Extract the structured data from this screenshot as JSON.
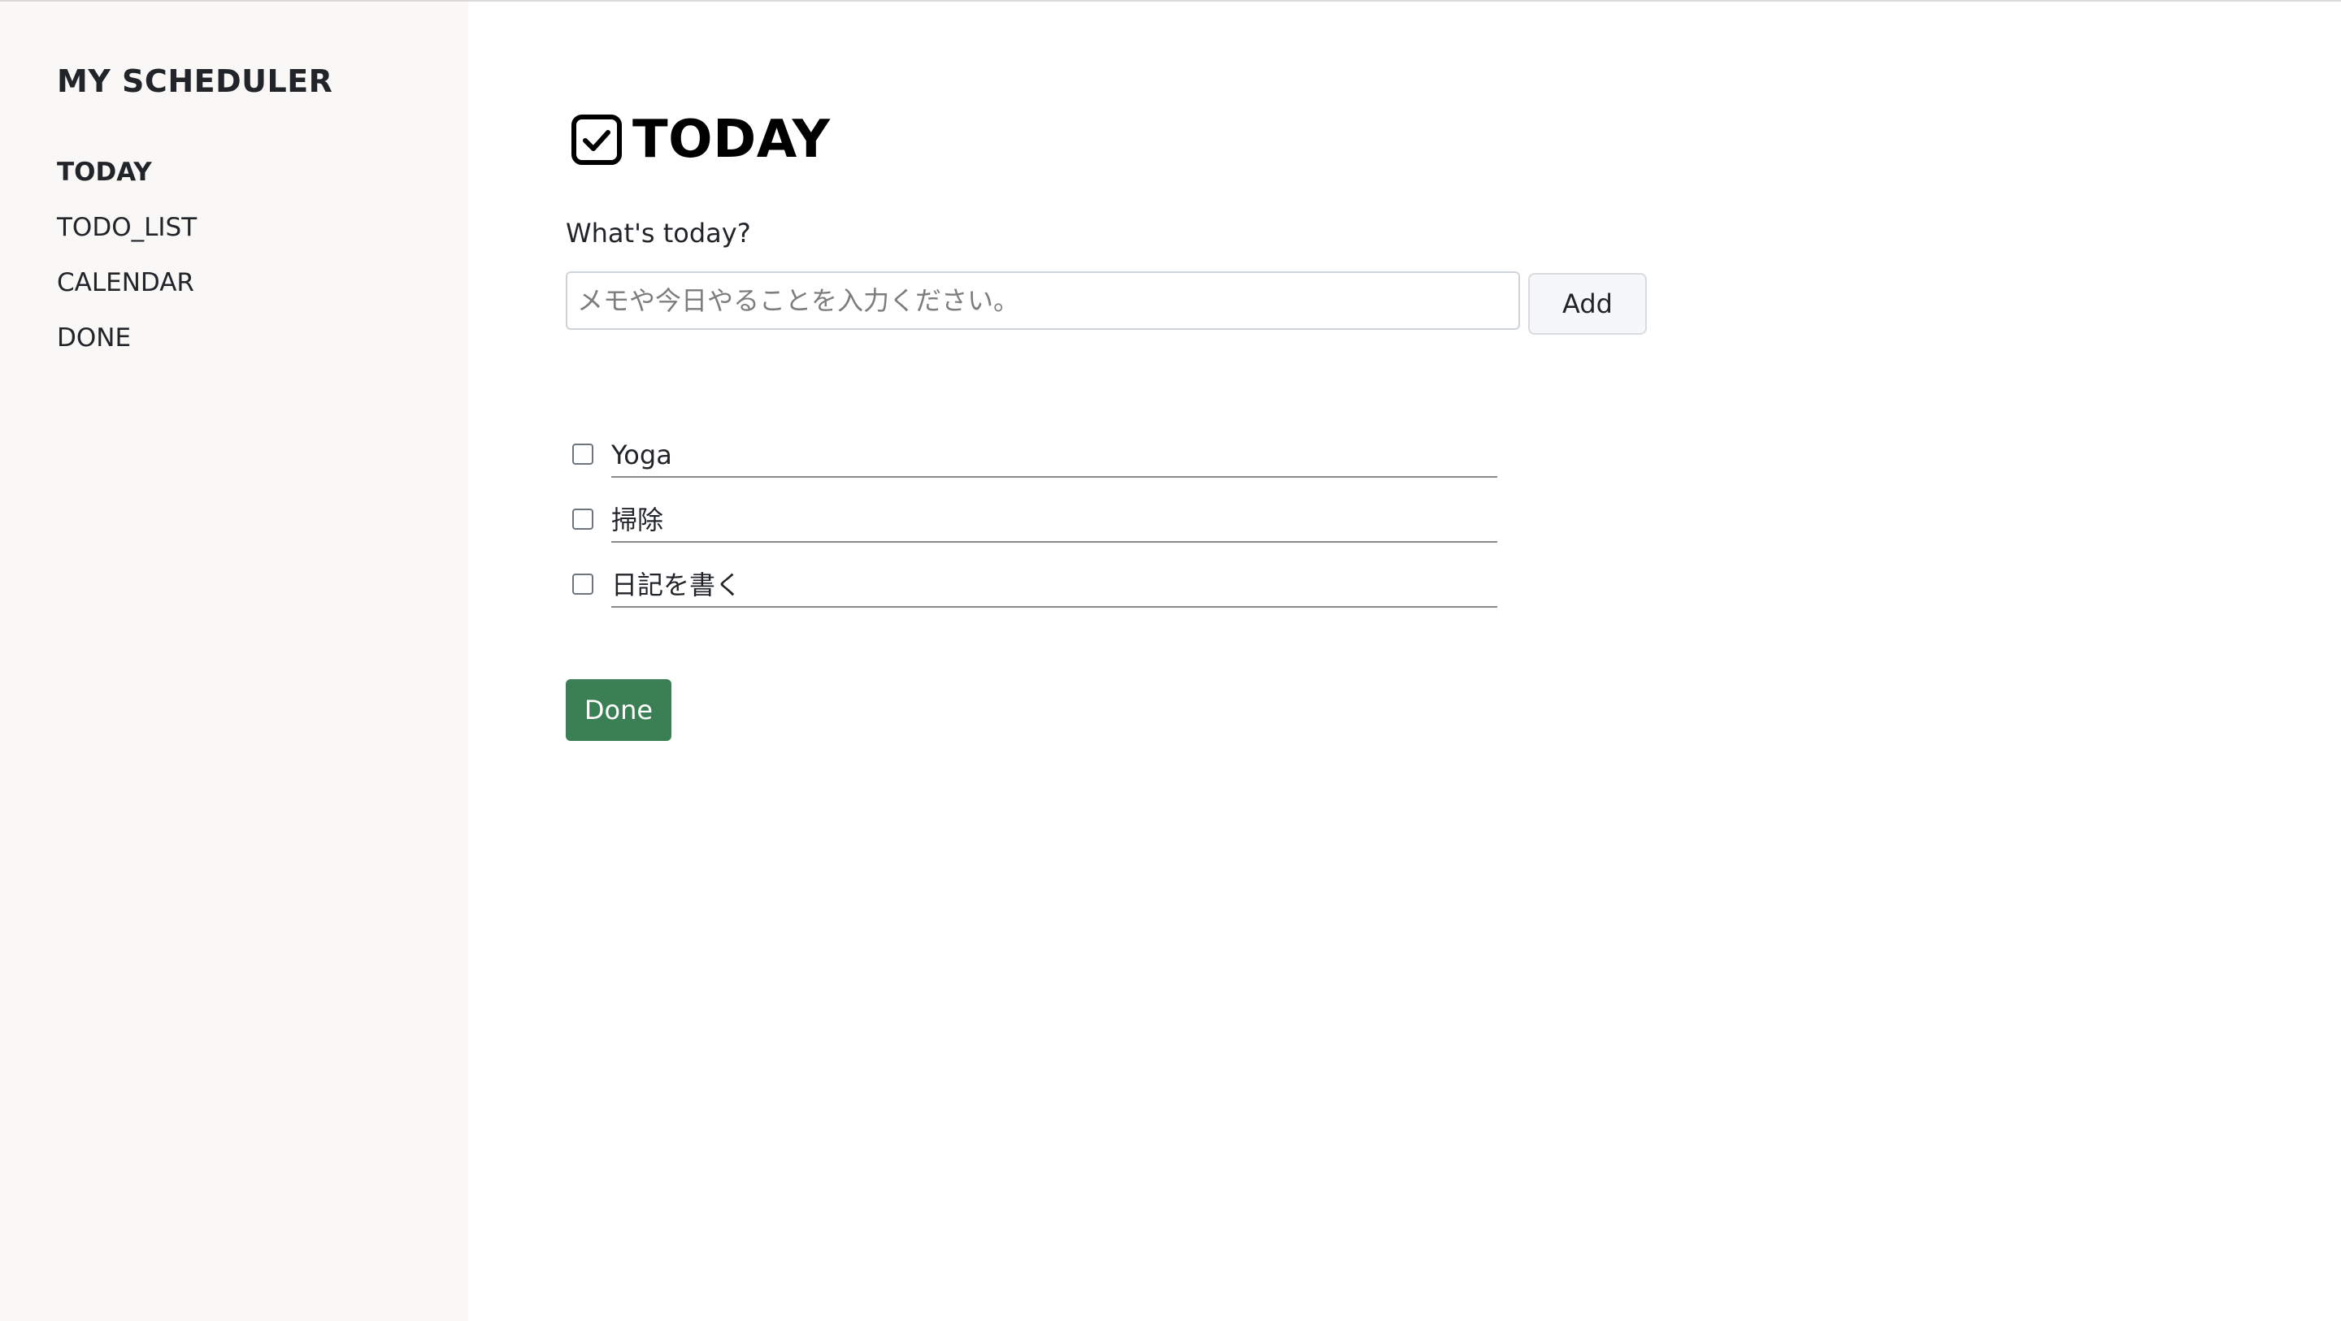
{
  "sidebar": {
    "brand": "MY SCHEDULER",
    "items": [
      {
        "label": "TODAY",
        "active": true
      },
      {
        "label": "TODO_LIST",
        "active": false
      },
      {
        "label": "CALENDAR",
        "active": false
      },
      {
        "label": "DONE",
        "active": false
      }
    ]
  },
  "main": {
    "title_icon": "checkbox-checked-icon",
    "title": "TODAY",
    "prompt": "What's today?",
    "memo_input": {
      "value": "",
      "placeholder": "メモや今日やることを入力ください。"
    },
    "add_label": "Add",
    "todos": [
      {
        "text": "Yoga",
        "checked": false
      },
      {
        "text": "掃除",
        "checked": false
      },
      {
        "text": "日記を書く",
        "checked": false
      }
    ],
    "done_label": "Done"
  },
  "colors": {
    "sidebar_bg": "#f9f8f7",
    "done_button": "#3a8054",
    "text": "#212529"
  }
}
